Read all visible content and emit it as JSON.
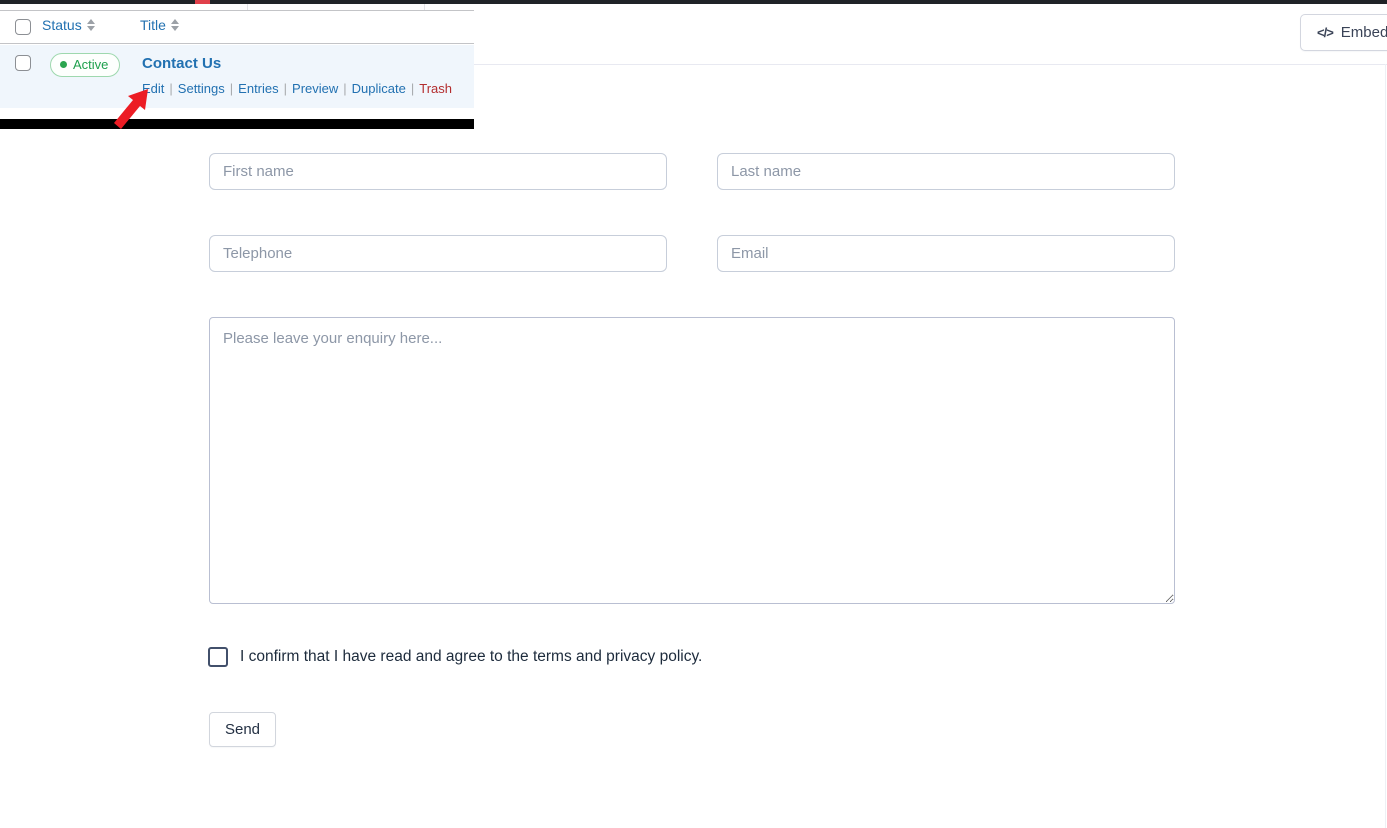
{
  "forms_table": {
    "columns": [
      {
        "label": "Status"
      },
      {
        "label": "Title"
      }
    ],
    "row": {
      "status_label": "Active",
      "title": "Contact Us",
      "actions": [
        "Edit",
        "Settings",
        "Entries",
        "Preview",
        "Duplicate",
        "Trash"
      ],
      "separator": "|"
    }
  },
  "header": {
    "embed_icon": "</>",
    "embed_label": "Embed"
  },
  "form": {
    "first_name_placeholder": "First name",
    "last_name_placeholder": "Last name",
    "telephone_placeholder": "Telephone",
    "email_placeholder": "Email",
    "message_placeholder": "Please leave your enquiry here...",
    "consent_label": "I confirm that I have read and agree to the terms and privacy policy.",
    "send_label": "Send"
  },
  "colors": {
    "link_blue": "#2271b1",
    "trash_red": "#b32d2e",
    "active_green": "#1ea04d",
    "arrow_red": "#ec1c24",
    "row_hover_bg": "#f0f6fc",
    "admin_bar": "#1f2327"
  }
}
